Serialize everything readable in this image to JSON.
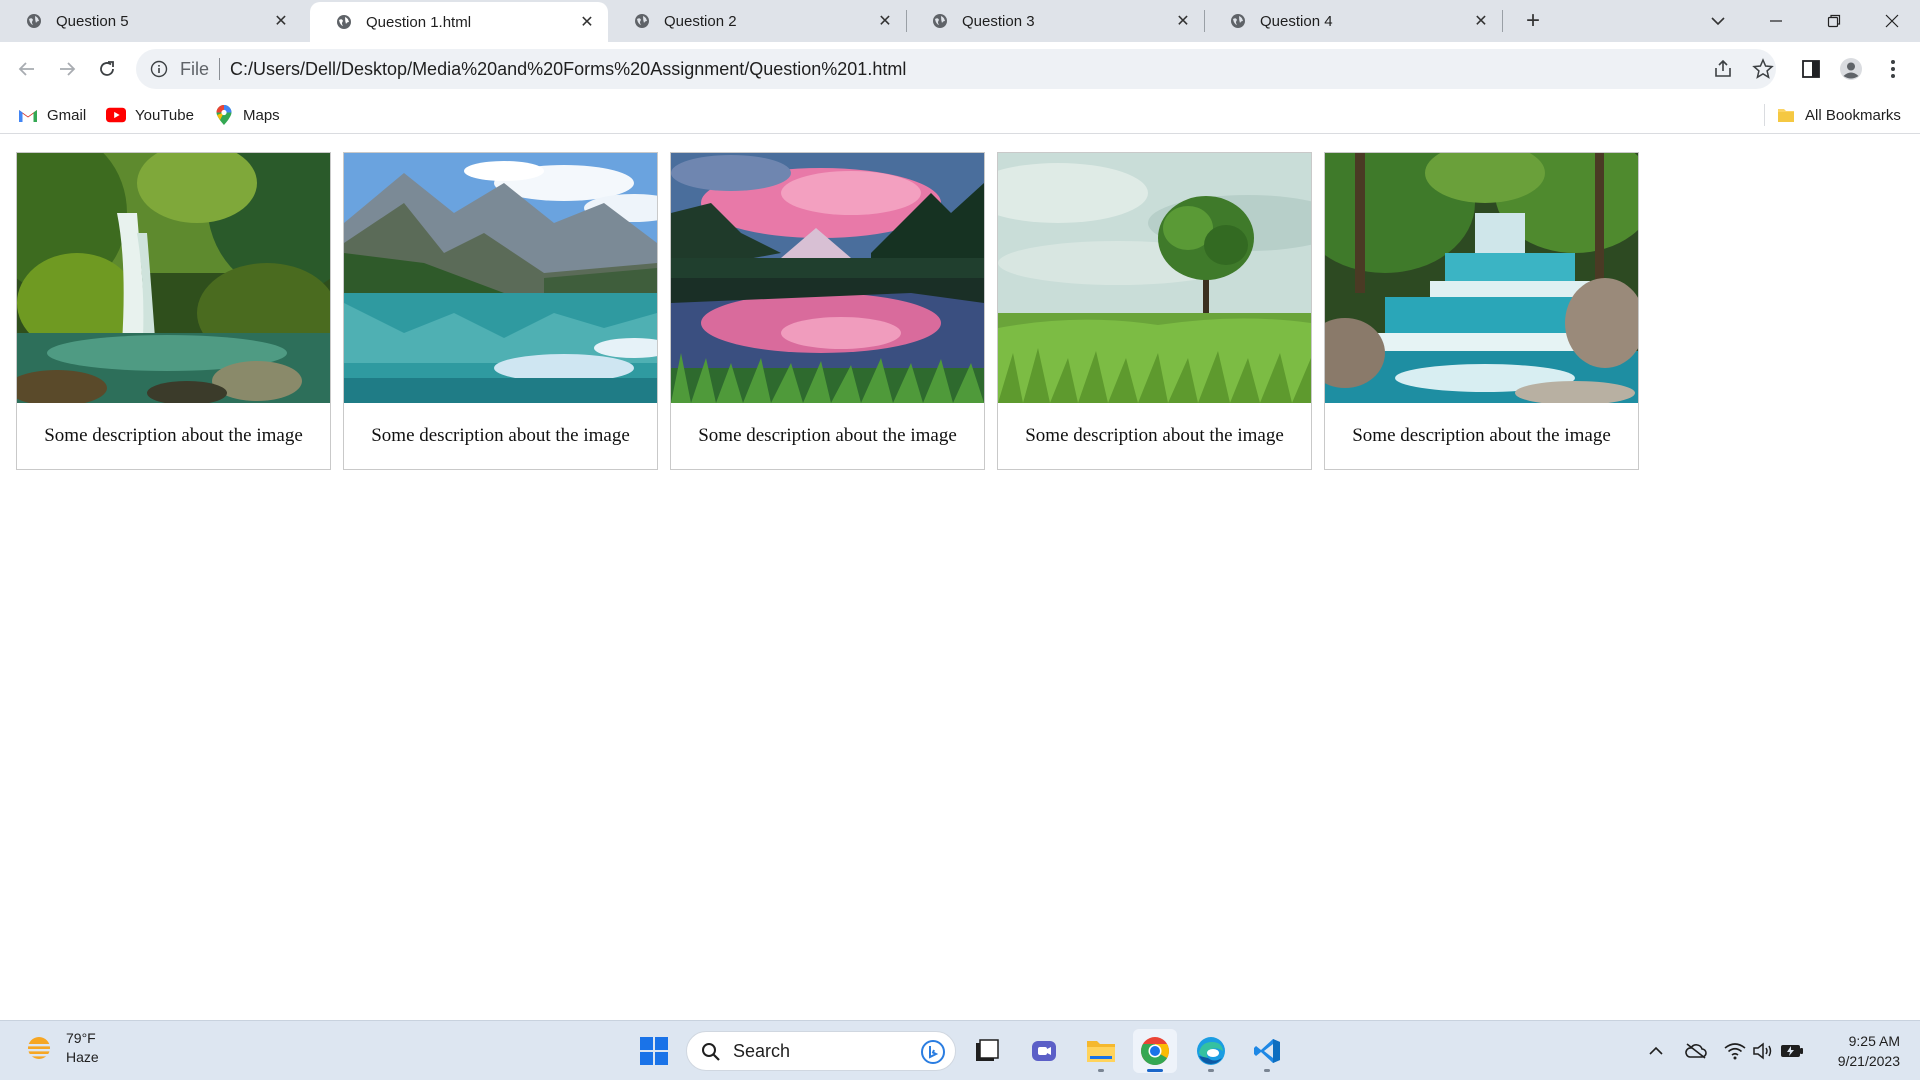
{
  "browser": {
    "tabs": [
      {
        "title": "Question 5",
        "active": false
      },
      {
        "title": "Question 1.html",
        "active": true
      },
      {
        "title": "Question 2",
        "active": false
      },
      {
        "title": "Question 3",
        "active": false
      },
      {
        "title": "Question 4",
        "active": false
      }
    ],
    "address": {
      "scheme": "File",
      "url": "C:/Users/Dell/Desktop/Media%20and%20Forms%20Assignment/Question%201.html"
    },
    "bookmarks": [
      {
        "label": "Gmail",
        "icon": "gmail-icon"
      },
      {
        "label": "YouTube",
        "icon": "youtube-icon"
      },
      {
        "label": "Maps",
        "icon": "maps-icon"
      }
    ],
    "all_bookmarks_label": "All Bookmarks"
  },
  "gallery": {
    "cards": [
      {
        "description": "Some description about the image",
        "scene": "waterfall in green forest"
      },
      {
        "description": "Some description about the image",
        "scene": "mountain lake reflection"
      },
      {
        "description": "Some description about the image",
        "scene": "pink sunset over mountain lake"
      },
      {
        "description": "Some description about the image",
        "scene": "lone tree in grass field"
      },
      {
        "description": "Some description about the image",
        "scene": "turquoise cascading waterfall"
      }
    ]
  },
  "taskbar": {
    "weather": {
      "temp": "79°F",
      "condition": "Haze"
    },
    "search_label": "Search",
    "clock": {
      "time": "9:25 AM",
      "date": "9/21/2023"
    }
  },
  "colors": {
    "tabstrip": "#dfe3e9",
    "omnibox": "#eef1f5",
    "taskbar": "#dde6f1",
    "accent": "#1a66c9"
  }
}
